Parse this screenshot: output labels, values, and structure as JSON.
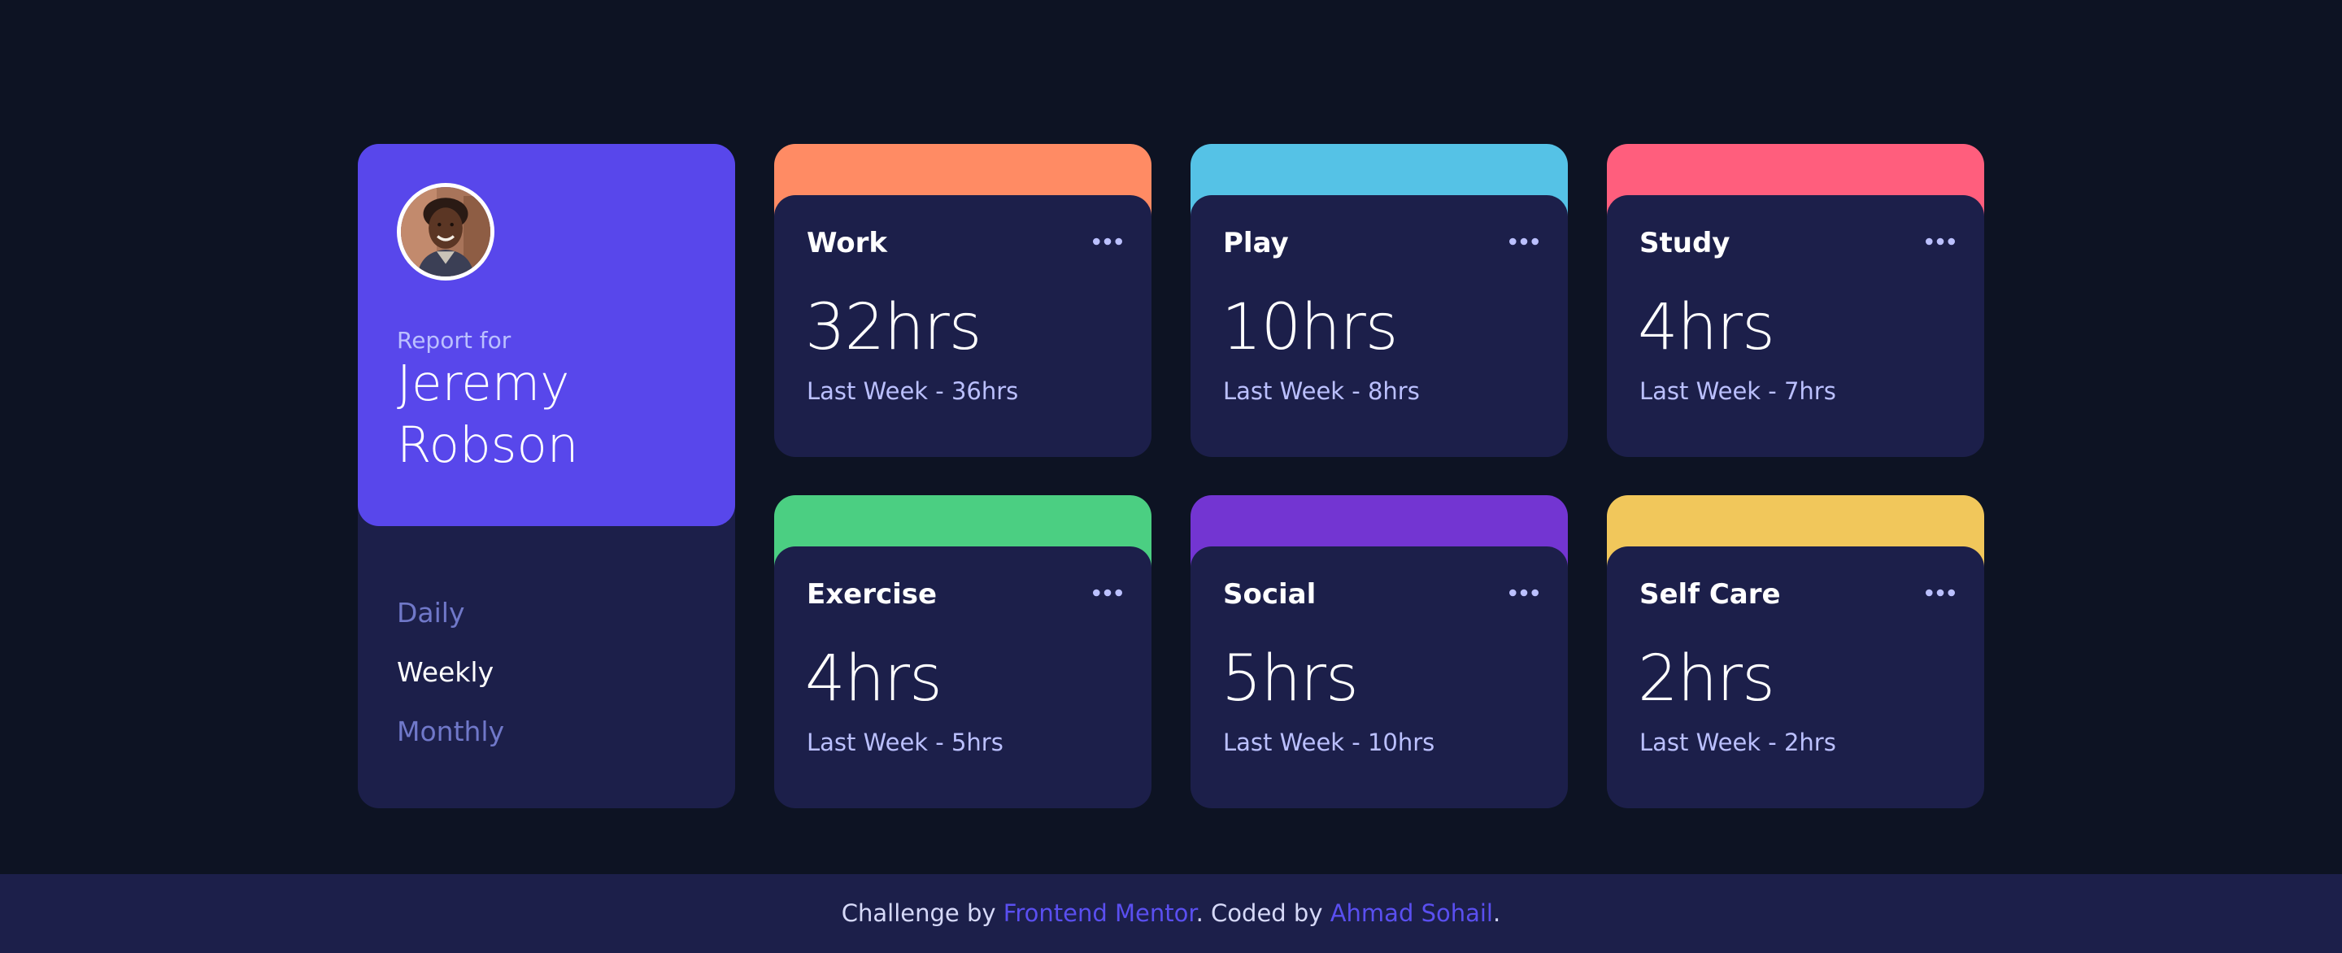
{
  "profile": {
    "report_label": "Report for",
    "name": "Jeremy Robson",
    "avatar_icon": "user-avatar-photo"
  },
  "timeframes": [
    {
      "label": "Daily",
      "active": false
    },
    {
      "label": "Weekly",
      "active": true
    },
    {
      "label": "Monthly",
      "active": false
    }
  ],
  "activities": [
    {
      "title": "Work",
      "current": "32hrs",
      "previous": "Last Week - 36hrs",
      "color": "#ff8b64"
    },
    {
      "title": "Play",
      "current": "10hrs",
      "previous": "Last Week - 8hrs",
      "color": "#55c2e6"
    },
    {
      "title": "Study",
      "current": "4hrs",
      "previous": "Last Week - 7hrs",
      "color": "#ff5e7d"
    },
    {
      "title": "Exercise",
      "current": "4hrs",
      "previous": "Last Week - 5hrs",
      "color": "#4bcf82"
    },
    {
      "title": "Social",
      "current": "5hrs",
      "previous": "Last Week - 10hrs",
      "color": "#7335d2"
    },
    {
      "title": "Self Care",
      "current": "2hrs",
      "previous": "Last Week - 2hrs",
      "color": "#f1c75b"
    }
  ],
  "footer": {
    "prefix": "Challenge by ",
    "link1": "Frontend Mentor",
    "middle": ". Coded by ",
    "link2": "Ahmad Sohail",
    "suffix": "."
  },
  "colors": {
    "background": "#0d1323",
    "card": "#1c1f4a",
    "profile": "#5847eb",
    "muted_text": "#bbc0ff",
    "inactive_link": "#7078c9"
  }
}
